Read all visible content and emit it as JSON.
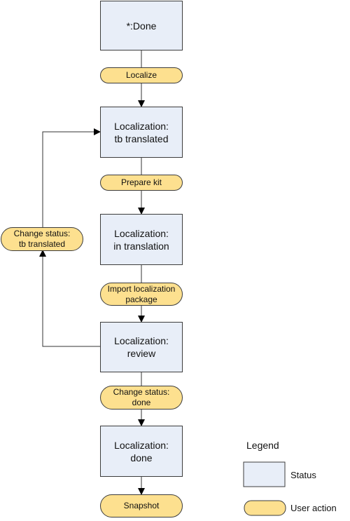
{
  "statuses": [
    {
      "id": "s0",
      "label": "*:Done"
    },
    {
      "id": "s1",
      "label": "Localization:\ntb translated"
    },
    {
      "id": "s2",
      "label": "Localization:\nin translation"
    },
    {
      "id": "s3",
      "label": "Localization:\nreview"
    },
    {
      "id": "s4",
      "label": "Localization:\ndone"
    }
  ],
  "actions": [
    {
      "id": "a0",
      "label": "Localize"
    },
    {
      "id": "a1",
      "label": "Prepare kit"
    },
    {
      "id": "a2",
      "label": "Import localization\npackage"
    },
    {
      "id": "a3",
      "label": "Change status:\ndone"
    },
    {
      "id": "a4",
      "label": "Snapshot"
    },
    {
      "id": "a5",
      "label": "Change status:\ntb translated"
    }
  ],
  "edges": [
    {
      "from": "s0",
      "to": "a0"
    },
    {
      "from": "a0",
      "to": "s1"
    },
    {
      "from": "s1",
      "to": "a1"
    },
    {
      "from": "a1",
      "to": "s2"
    },
    {
      "from": "s2",
      "to": "a2"
    },
    {
      "from": "a2",
      "to": "s3"
    },
    {
      "from": "s3",
      "to": "a3"
    },
    {
      "from": "a3",
      "to": "s4"
    },
    {
      "from": "s4",
      "to": "a4"
    },
    {
      "from": "s3",
      "to": "a5"
    },
    {
      "from": "a5",
      "to": "s1"
    }
  ],
  "legend": {
    "title": "Legend",
    "status_label": "Status",
    "action_label": "User action"
  },
  "colors": {
    "status_fill": "#e8eef8",
    "action_fill": "#fde08f",
    "stroke": "#3c3c3c"
  }
}
